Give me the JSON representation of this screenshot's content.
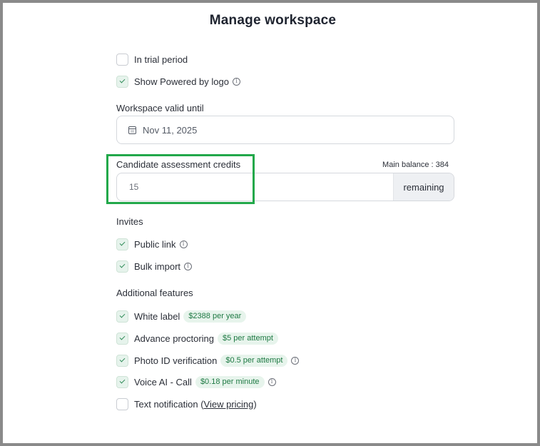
{
  "title": "Manage workspace",
  "top_options": [
    {
      "label": "In trial period",
      "checked": false,
      "info": false
    },
    {
      "label": "Show Powered by logo",
      "checked": true,
      "info": true
    }
  ],
  "valid_until": {
    "label": "Workspace valid until",
    "value": "Nov 11, 2025",
    "icon": "calendar-icon"
  },
  "credits": {
    "label": "Candidate assessment credits",
    "balance": "Main balance : 384",
    "value": "15",
    "suffix": "remaining"
  },
  "invites": {
    "heading": "Invites",
    "items": [
      {
        "label": "Public link",
        "checked": true,
        "info": true
      },
      {
        "label": "Bulk import",
        "checked": true,
        "info": true
      }
    ]
  },
  "features": {
    "heading": "Additional features",
    "items": [
      {
        "label": "White label",
        "checked": true,
        "badge": "$2388 per year",
        "info": false
      },
      {
        "label": "Advance proctoring",
        "checked": true,
        "badge": "$5 per attempt",
        "info": false
      },
      {
        "label": "Photo ID verification",
        "checked": true,
        "badge": "$0.5 per attempt",
        "info": true
      },
      {
        "label": "Voice AI - Call",
        "checked": true,
        "badge": "$0.18 per minute",
        "info": true
      }
    ],
    "text_notification": {
      "label": "Text notification (",
      "link": "View pricing",
      "close": ")",
      "checked": false
    }
  },
  "colors": {
    "highlight": "#22a84a",
    "check_bg": "#e6f3ec",
    "badge_text": "#1f7a44"
  }
}
